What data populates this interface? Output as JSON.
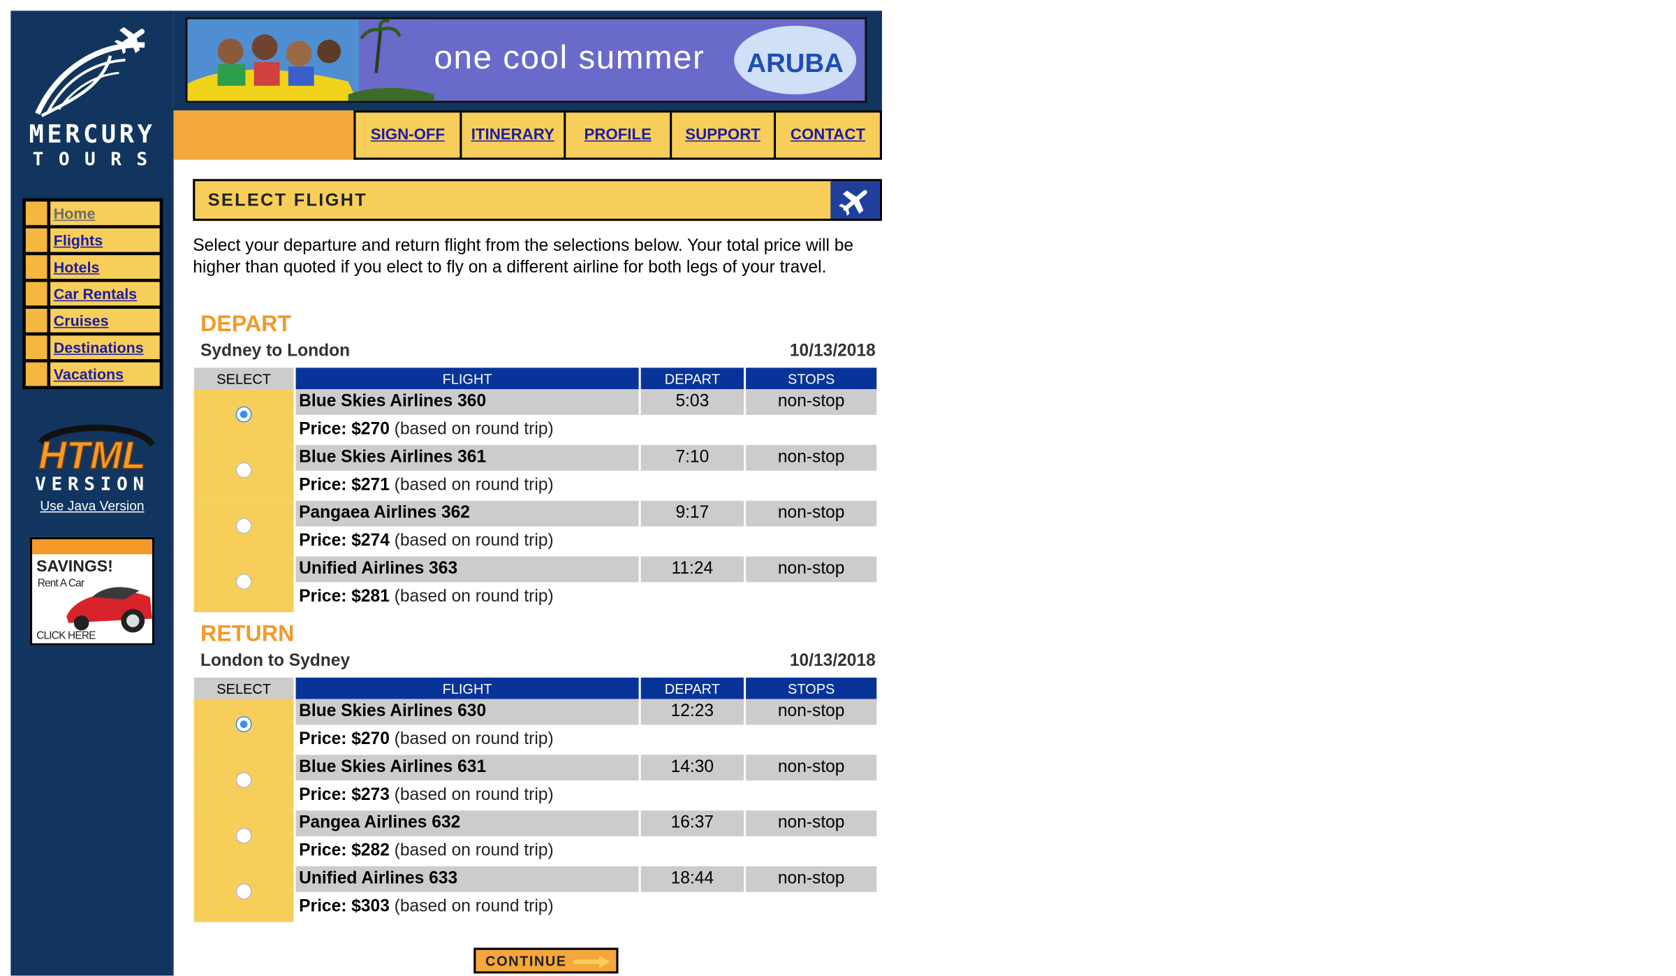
{
  "sidebar": {
    "logo_line1": "MERCURY",
    "logo_line2": "TOURS",
    "nav": [
      {
        "label": "Home"
      },
      {
        "label": "Flights"
      },
      {
        "label": "Hotels"
      },
      {
        "label": "Car Rentals"
      },
      {
        "label": "Cruises"
      },
      {
        "label": "Destinations"
      },
      {
        "label": "Vacations"
      }
    ],
    "html_version_line1": "HTML",
    "html_version_line2": "VERSION",
    "java_link": "Use Java Version",
    "ad": {
      "title": "SAVINGS!",
      "subtitle": "Rent A Car",
      "cta": "CLICK HERE"
    }
  },
  "banner": {
    "text": "one cool summer",
    "brand": "ARUBA"
  },
  "topnav": [
    {
      "label": "SIGN-OFF"
    },
    {
      "label": "ITINERARY"
    },
    {
      "label": "PROFILE"
    },
    {
      "label": "SUPPORT"
    },
    {
      "label": "CONTACT"
    }
  ],
  "page_title": "SELECT FLIGHT",
  "intro": "Select your departure and return flight from the selections below. Your total price will be higher than quoted if you elect to fly on a different airline for both legs of your travel.",
  "columns": {
    "select": "SELECT",
    "flight": "FLIGHT",
    "depart": "DEPART",
    "stops": "STOPS"
  },
  "depart": {
    "label": "DEPART",
    "route": "Sydney to London",
    "date": "10/13/2018",
    "flights": [
      {
        "name": "Blue Skies Airlines 360",
        "time": "5:03",
        "stops": "non-stop",
        "price": "$270",
        "note": "(based on round trip)",
        "selected": true
      },
      {
        "name": "Blue Skies Airlines 361",
        "time": "7:10",
        "stops": "non-stop",
        "price": "$271",
        "note": "(based on round trip)",
        "selected": false
      },
      {
        "name": "Pangaea Airlines 362",
        "time": "9:17",
        "stops": "non-stop",
        "price": "$274",
        "note": "(based on round trip)",
        "selected": false
      },
      {
        "name": "Unified Airlines 363",
        "time": "11:24",
        "stops": "non-stop",
        "price": "$281",
        "note": "(based on round trip)",
        "selected": false
      }
    ]
  },
  "return": {
    "label": "RETURN",
    "route": "London to Sydney",
    "date": "10/13/2018",
    "flights": [
      {
        "name": "Blue Skies Airlines 630",
        "time": "12:23",
        "stops": "non-stop",
        "price": "$270",
        "note": "(based on round trip)",
        "selected": true
      },
      {
        "name": "Blue Skies Airlines 631",
        "time": "14:30",
        "stops": "non-stop",
        "price": "$273",
        "note": "(based on round trip)",
        "selected": false
      },
      {
        "name": "Pangea Airlines 632",
        "time": "16:37",
        "stops": "non-stop",
        "price": "$282",
        "note": "(based on round trip)",
        "selected": false
      },
      {
        "name": "Unified Airlines 633",
        "time": "18:44",
        "stops": "non-stop",
        "price": "$303",
        "note": "(based on round trip)",
        "selected": false
      }
    ]
  },
  "price_label": "Price:",
  "continue_label": "CONTINUE",
  "colors": {
    "navy": "#11355f",
    "gold": "#f8ce5b",
    "orange": "#f4a73b",
    "header_blue": "#083399"
  }
}
